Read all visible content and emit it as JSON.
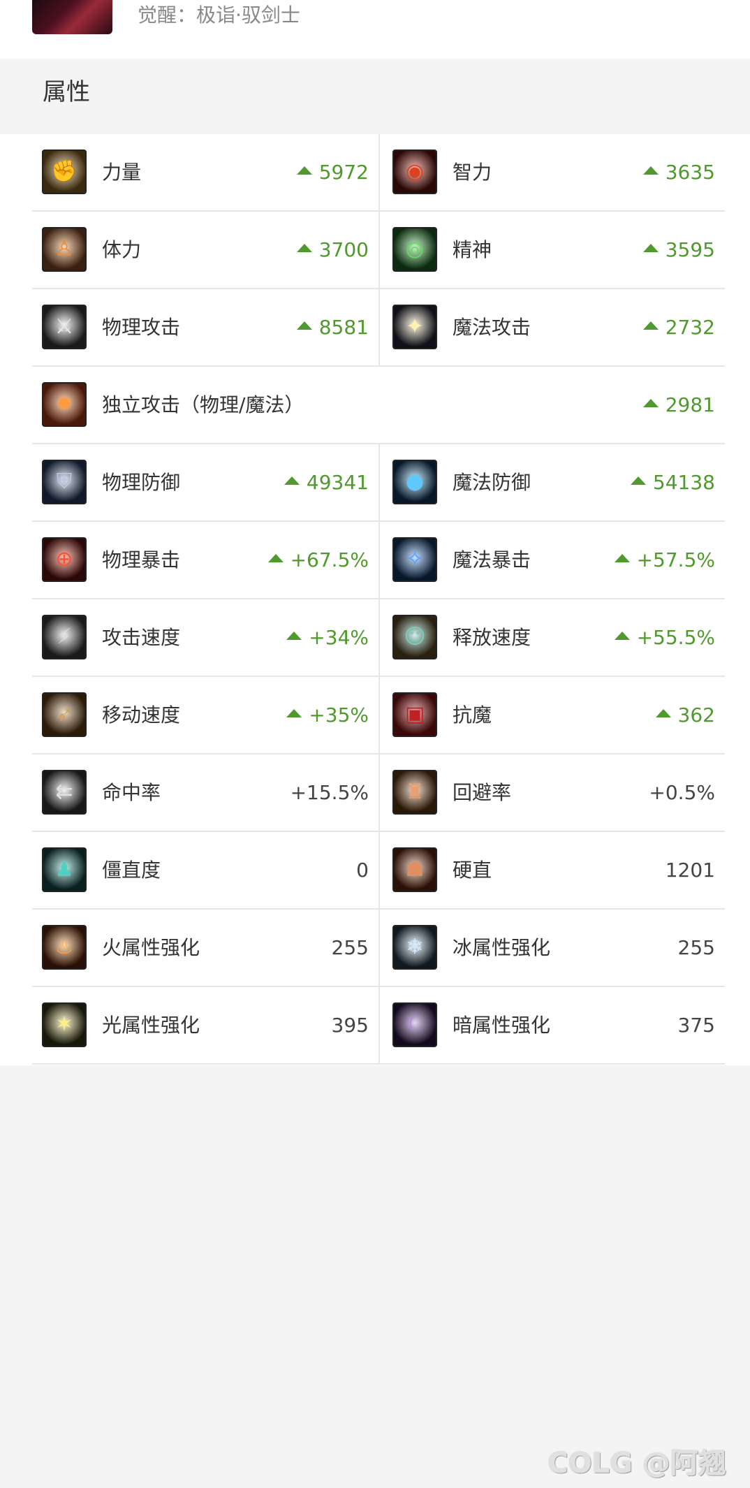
{
  "header": {
    "awaken_text": "觉醒：极诣·驭剑士"
  },
  "section": {
    "title": "属性"
  },
  "rows": [
    {
      "type": "pair",
      "left": {
        "label": "力量",
        "value": "5972",
        "up": true,
        "icon": "fist-icon"
      },
      "right": {
        "label": "智力",
        "value": "3635",
        "up": true,
        "icon": "eye-icon"
      }
    },
    {
      "type": "pair",
      "left": {
        "label": "体力",
        "value": "3700",
        "up": true,
        "icon": "body-icon"
      },
      "right": {
        "label": "精神",
        "value": "3595",
        "up": true,
        "icon": "spirit-eye-icon"
      }
    },
    {
      "type": "pair",
      "left": {
        "label": "物理攻击",
        "value": "8581",
        "up": true,
        "icon": "sword-icon"
      },
      "right": {
        "label": "魔法攻击",
        "value": "2732",
        "up": true,
        "icon": "sparkle-icon"
      }
    },
    {
      "type": "full",
      "full": {
        "label": "独立攻击（物理/魔法）",
        "value": "2981",
        "up": true,
        "icon": "burst-icon"
      }
    },
    {
      "type": "pair",
      "left": {
        "label": "物理防御",
        "value": "49341",
        "up": true,
        "icon": "shield-icon"
      },
      "right": {
        "label": "魔法防御",
        "value": "54138",
        "up": true,
        "icon": "orb-icon"
      }
    },
    {
      "type": "pair",
      "left": {
        "label": "物理暴击",
        "value": "+67.5%",
        "up": true,
        "icon": "crosshair-icon"
      },
      "right": {
        "label": "魔法暴击",
        "value": "+57.5%",
        "up": true,
        "icon": "magic-crosshair-icon"
      }
    },
    {
      "type": "pair",
      "left": {
        "label": "攻击速度",
        "value": "+34%",
        "up": true,
        "icon": "fast-sword-icon"
      },
      "right": {
        "label": "释放速度",
        "value": "+55.5%",
        "up": true,
        "icon": "caster-icon"
      }
    },
    {
      "type": "pair",
      "left": {
        "label": "移动速度",
        "value": "+35%",
        "up": true,
        "icon": "boot-icon"
      },
      "right": {
        "label": "抗魔",
        "value": "362",
        "up": true,
        "icon": "helmet-icon"
      }
    },
    {
      "type": "pair",
      "left": {
        "label": "命中率",
        "value": "+15.5%",
        "up": false,
        "icon": "target-arrow-icon"
      },
      "right": {
        "label": "回避率",
        "value": "+0.5%",
        "up": false,
        "icon": "dodge-icon"
      }
    },
    {
      "type": "pair",
      "left": {
        "label": "僵直度",
        "value": "0",
        "up": false,
        "icon": "stagger-icon"
      },
      "right": {
        "label": "硬直",
        "value": "1201",
        "up": false,
        "icon": "muscle-icon"
      }
    },
    {
      "type": "pair",
      "left": {
        "label": "火属性强化",
        "value": "255",
        "up": false,
        "icon": "fire-icon"
      },
      "right": {
        "label": "冰属性强化",
        "value": "255",
        "up": false,
        "icon": "ice-icon"
      }
    },
    {
      "type": "pair",
      "left": {
        "label": "光属性强化",
        "value": "395",
        "up": false,
        "icon": "light-icon"
      },
      "right": {
        "label": "暗属性强化",
        "value": "375",
        "up": false,
        "icon": "dark-icon"
      }
    }
  ],
  "watermark": {
    "text": "COLG @阿翘"
  },
  "colors": {
    "up_green": "#4f9a2c"
  }
}
